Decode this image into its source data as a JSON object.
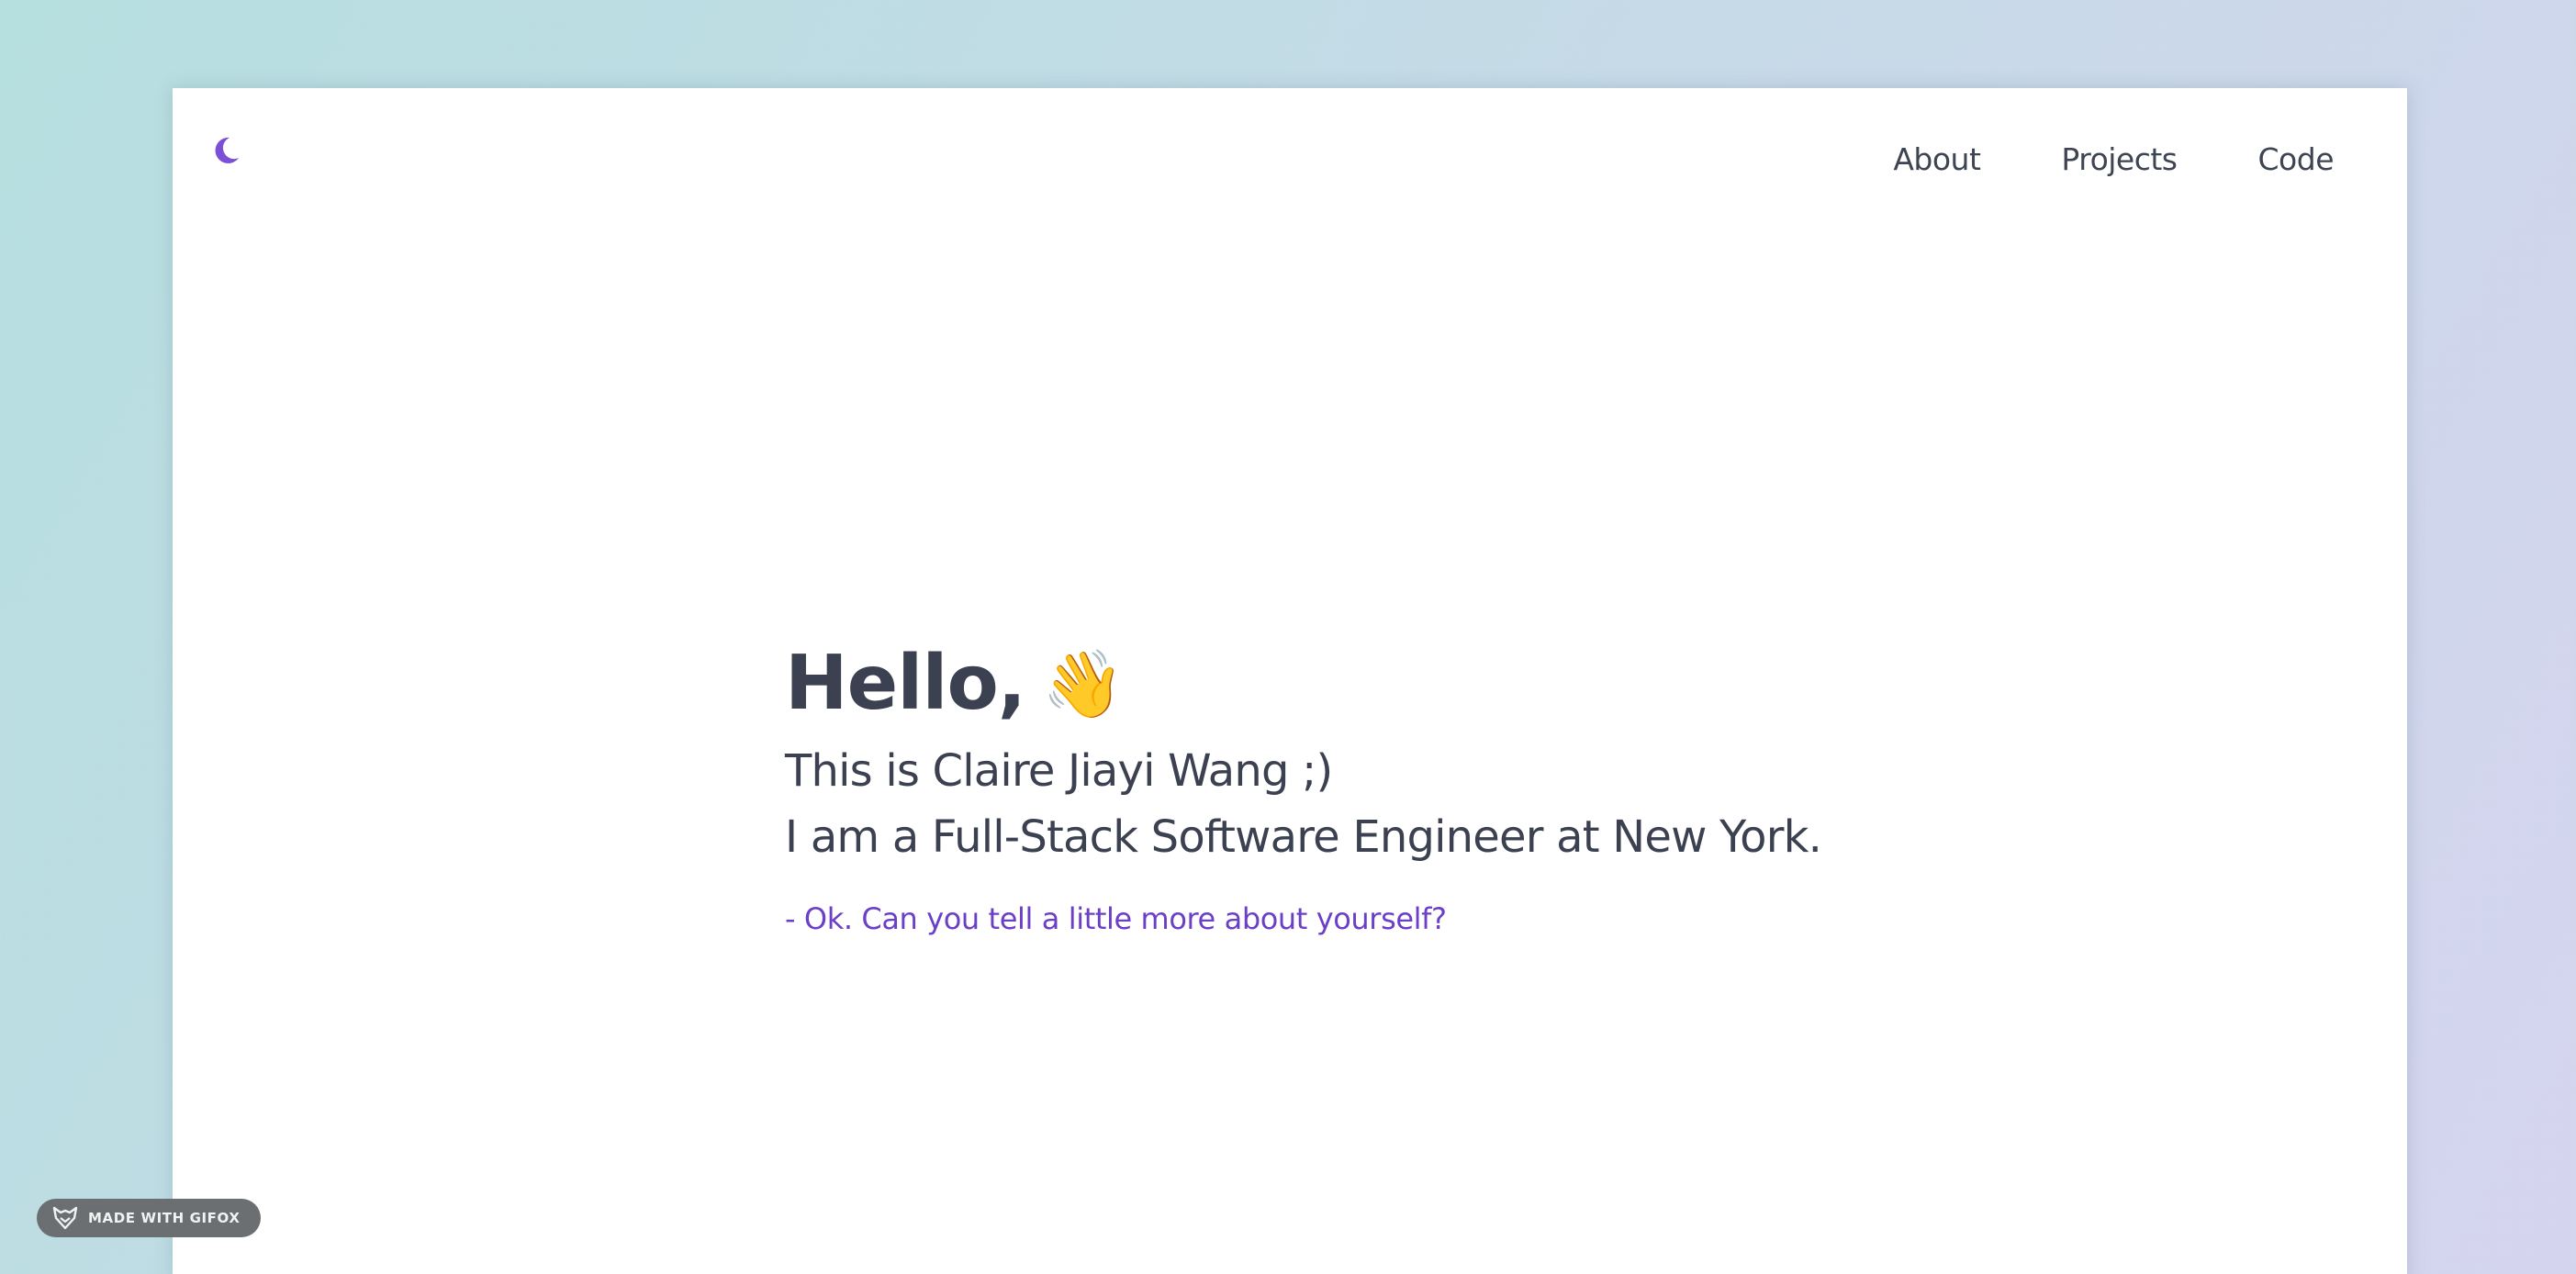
{
  "nav": {
    "items": [
      {
        "label": "About"
      },
      {
        "label": "Projects"
      },
      {
        "label": "Code"
      }
    ]
  },
  "theme_toggle": {
    "icon": "moon-icon",
    "color": "#7b4fd6"
  },
  "hero": {
    "greeting": "Hello,",
    "wave_emoji": "👋",
    "line1": "This is Claire Jiayi Wang ;)",
    "line2": "I am a Full-Stack Software Engineer at New York.",
    "cta": "- Ok. Can you tell a little more about yourself?"
  },
  "badge": {
    "label": "MADE WITH GIFOX",
    "icon": "fox-icon"
  },
  "colors": {
    "text": "#3b4150",
    "accent": "#6b3fc6",
    "moon": "#7b4fd6"
  }
}
